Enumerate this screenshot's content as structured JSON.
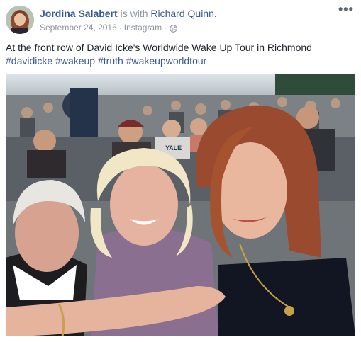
{
  "post": {
    "author": "Jordina Salabert",
    "with_text": "is with",
    "tagged_person": "Richard Quinn.",
    "date": "September 24, 2016",
    "source": "Instagram",
    "separator": "·",
    "privacy_icon": "globe-icon",
    "more_icon": "more-options-icon",
    "more_label": "•••",
    "caption": "At the front row of David Icke's Worldwide Wake Up Tour in Richmond",
    "hashtags": [
      "#davidicke",
      "#wakeup",
      "#truth",
      "#wakeupworldtour"
    ],
    "photo_shirt_text": "YALE"
  },
  "colors": {
    "link": "#365899",
    "meta": "#90949c",
    "text": "#1d2129"
  }
}
